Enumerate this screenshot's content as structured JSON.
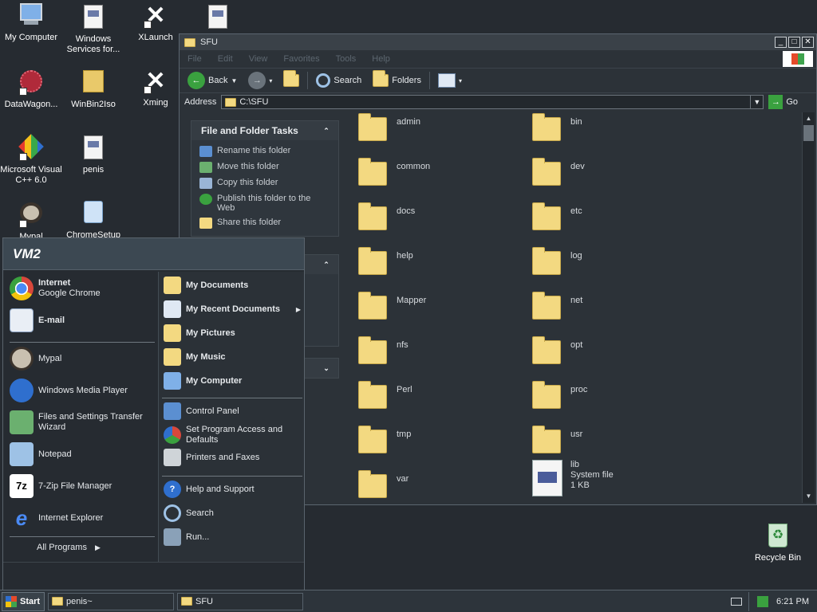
{
  "desktop": {
    "icons": [
      {
        "label": "My Computer"
      },
      {
        "label": "Windows Services for..."
      },
      {
        "label": "XLaunch"
      },
      {
        "label": ""
      },
      {
        "label": "DataWagon..."
      },
      {
        "label": "WinBin2Iso"
      },
      {
        "label": "Xming"
      },
      {
        "label": "Microsoft Visual C++ 6.0"
      },
      {
        "label": "penis"
      },
      {
        "label": "Mypal"
      },
      {
        "label": "ChromeSetup"
      },
      {
        "label": "Recycle Bin"
      }
    ]
  },
  "window": {
    "title": "SFU",
    "menu": [
      "File",
      "Edit",
      "View",
      "Favorites",
      "Tools",
      "Help"
    ],
    "toolbar": {
      "back": "Back",
      "search": "Search",
      "folders": "Folders"
    },
    "address": {
      "label": "Address",
      "value": "C:\\SFU",
      "go": "Go"
    },
    "tasks_panel": {
      "title": "File and Folder Tasks",
      "items": [
        "Rename this folder",
        "Move this folder",
        "Copy this folder",
        "Publish this folder to the Web",
        "Share this folder"
      ]
    },
    "folders_left": [
      "admin",
      "common",
      "docs",
      "help",
      "Mapper",
      "nfs",
      "Perl",
      "tmp",
      "var"
    ],
    "folders_right": [
      "bin",
      "dev",
      "etc",
      "log",
      "net",
      "opt",
      "proc",
      "usr"
    ],
    "file": {
      "name": "lib",
      "type": "System file",
      "size": "1 KB"
    }
  },
  "start_menu": {
    "user": "VM2",
    "pinned": [
      {
        "title": "Internet",
        "sub": "Google Chrome"
      },
      {
        "title": "E-mail",
        "sub": ""
      }
    ],
    "recent": [
      "Mypal",
      "Windows Media Player",
      "Files and Settings Transfer Wizard",
      "Notepad",
      "7-Zip File Manager",
      "Internet Explorer"
    ],
    "all_programs": "All Programs",
    "right_top": [
      "My Documents",
      "My Recent Documents",
      "My Pictures",
      "My Music",
      "My Computer"
    ],
    "right_mid": [
      "Control Panel",
      "Set Program Access and Defaults",
      "Printers and Faxes"
    ],
    "right_bottom": [
      "Help and Support",
      "Search",
      "Run..."
    ]
  },
  "taskbar": {
    "start": "Start",
    "tasks": [
      "penis~",
      "SFU"
    ],
    "clock": "6:21 PM"
  },
  "colors": {
    "folder": "#f3d981",
    "chrome_red": "#d8473b",
    "xp_blue": "#2f6fce",
    "green": "#3aa13f"
  }
}
